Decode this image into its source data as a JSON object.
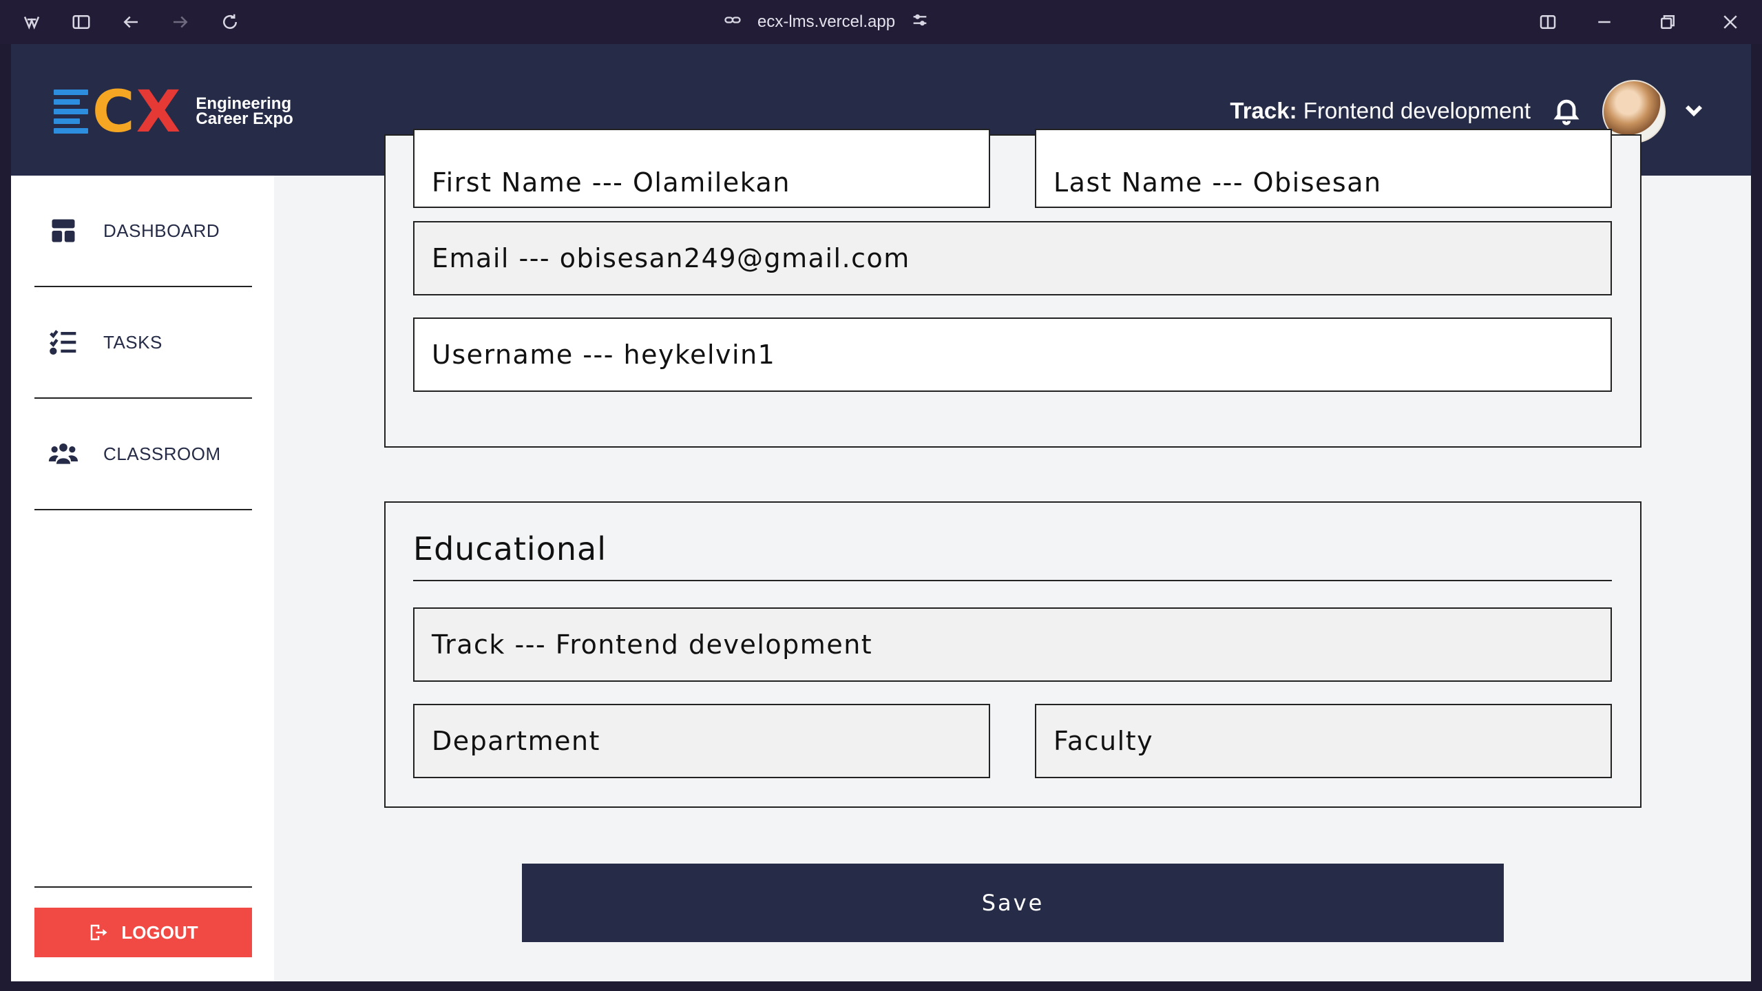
{
  "browser": {
    "url": "ecx-lms.vercel.app"
  },
  "header": {
    "logo_letters": "ECX",
    "logo_line1": "Engineering",
    "logo_line2": "Career Expo",
    "track_label": "Track:",
    "track_value": "Frontend development"
  },
  "sidebar": {
    "items": [
      {
        "label": "DASHBOARD",
        "icon": "dashboard-icon"
      },
      {
        "label": "TASKS",
        "icon": "tasks-icon"
      },
      {
        "label": "CLASSROOM",
        "icon": "classroom-icon"
      }
    ],
    "logout_label": "LOGOUT"
  },
  "form": {
    "personal": {
      "first_name": "First Name --- Olamilekan",
      "last_name": "Last Name --- Obisesan",
      "email": "Email --- obisesan249@gmail.com",
      "username": "Username --- heykelvin1"
    },
    "educational": {
      "title": "Educational",
      "track": "Track --- Frontend development",
      "department": "Department",
      "faculty": "Faculty"
    },
    "save_label": "Save"
  },
  "colors": {
    "navy": "#262c47",
    "logout_red": "#f14a44",
    "logo_blue": "#2d8ee0",
    "logo_orange": "#f5a623",
    "logo_red": "#e53935"
  }
}
